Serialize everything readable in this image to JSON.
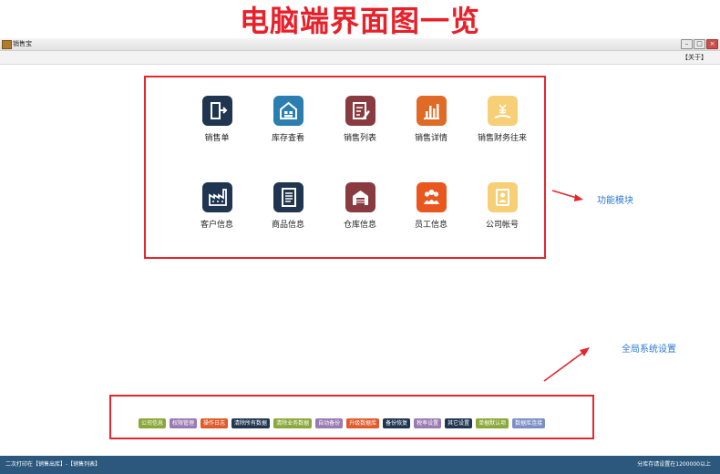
{
  "banner": {
    "title": "电脑端界面图一览"
  },
  "window": {
    "title": "销售宝",
    "about_label": "【关于】"
  },
  "modules": [
    {
      "label": "销售单",
      "color": "#1f3550",
      "icon": "exit-door-icon"
    },
    {
      "label": "库存查看",
      "color": "#2a7fb0",
      "icon": "warehouse-icon"
    },
    {
      "label": "销售列表",
      "color": "#8a3b3f",
      "icon": "list-edit-icon"
    },
    {
      "label": "销售详情",
      "color": "#e06b27",
      "icon": "bar-chart-icon"
    },
    {
      "label": "销售财务往来",
      "color": "#f7cf77",
      "icon": "money-icon"
    },
    {
      "label": "客户信息",
      "color": "#1f3550",
      "icon": "factory-icon"
    },
    {
      "label": "商品信息",
      "color": "#1f3550",
      "icon": "document-icon"
    },
    {
      "label": "仓库信息",
      "color": "#8a3b3f",
      "icon": "storehouse-icon"
    },
    {
      "label": "员工信息",
      "color": "#e9561e",
      "icon": "people-icon"
    },
    {
      "label": "公司帐号",
      "color": "#f7cf77",
      "icon": "id-card-icon"
    }
  ],
  "annotations": {
    "modules": "功能模块",
    "settings": "全局系统设置"
  },
  "settings": [
    {
      "label": "公司信息",
      "color": "#8aa83a"
    },
    {
      "label": "权限管理",
      "color": "#9a7ab3"
    },
    {
      "label": "操作日志",
      "color": "#e05a2a"
    },
    {
      "label": "清除所有数据",
      "color": "#1f3550"
    },
    {
      "label": "清除业务数据",
      "color": "#8aa83a"
    },
    {
      "label": "自动备份",
      "color": "#9a7ab3"
    },
    {
      "label": "升级数据库",
      "color": "#e05a2a"
    },
    {
      "label": "备份恢复",
      "color": "#1f3550"
    },
    {
      "label": "税率设置",
      "color": "#9a7ab3"
    },
    {
      "label": "其它设置",
      "color": "#1f3550"
    },
    {
      "label": "单据默认项",
      "color": "#8aa83a"
    },
    {
      "label": "数据库连接",
      "color": "#7c8fc4"
    }
  ],
  "status": {
    "left": "二次打印在【销售出库】-【销售列表】",
    "right": "分库存请设置在1200000以上"
  }
}
